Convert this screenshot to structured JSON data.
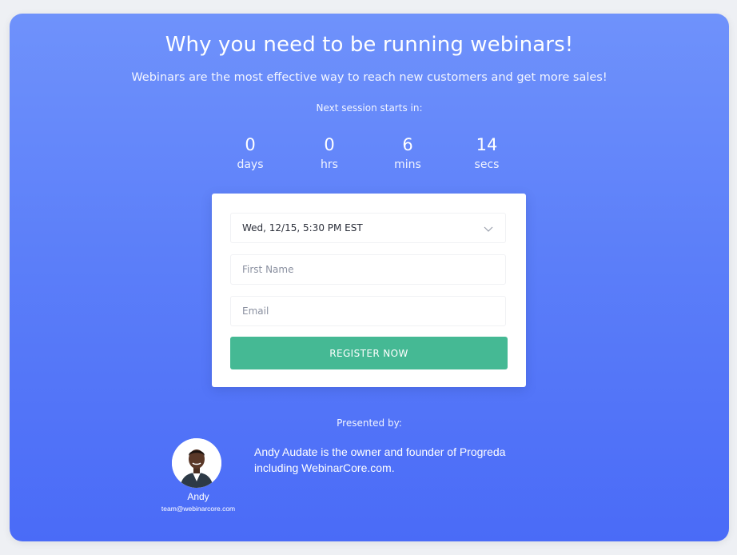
{
  "header": {
    "title": "Why you need to be running webinars!",
    "subtitle": "Webinars are the most effective way to reach new customers and get more sales!",
    "next_session_label": "Next session starts in:"
  },
  "countdown": [
    {
      "value": "0",
      "label": "days"
    },
    {
      "value": "0",
      "label": "hrs"
    },
    {
      "value": "6",
      "label": "mins"
    },
    {
      "value": "14",
      "label": "secs"
    }
  ],
  "form": {
    "session_select": {
      "selected": "Wed, 12/15, 5:30 PM EST",
      "icon": "chevron-down-icon"
    },
    "first_name": {
      "placeholder": "First Name",
      "value": ""
    },
    "email": {
      "placeholder": "Email",
      "value": ""
    },
    "register_label": "REGISTER NOW"
  },
  "presenter": {
    "heading": "Presented by:",
    "name": "Andy",
    "email": "team@webinarcore.com",
    "bio": "Andy Audate is the owner and founder of Progreda including WebinarCore.com."
  },
  "colors": {
    "accent_green": "#45b994",
    "gradient_top": "#6f92fb",
    "gradient_bottom": "#4a6bf7"
  }
}
